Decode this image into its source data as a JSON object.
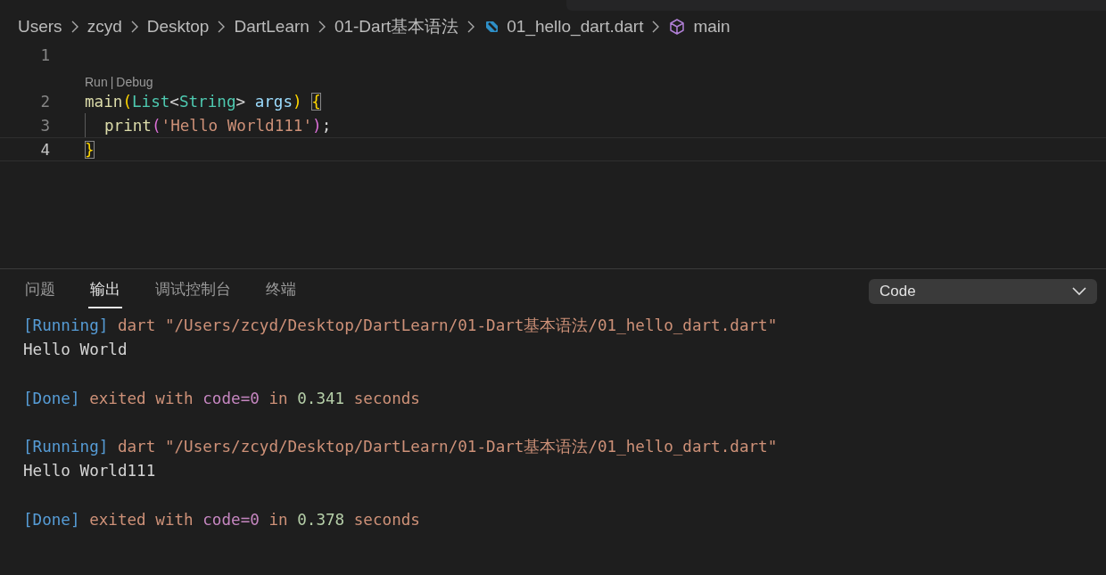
{
  "breadcrumb": [
    {
      "kind": "folder",
      "label": "Users"
    },
    {
      "kind": "folder",
      "label": "zcyd"
    },
    {
      "kind": "folder",
      "label": "Desktop"
    },
    {
      "kind": "folder",
      "label": "DartLearn"
    },
    {
      "kind": "folder",
      "label": "01-Dart基本语法"
    },
    {
      "kind": "file",
      "label": "01_hello_dart.dart"
    },
    {
      "kind": "symbol",
      "label": "main"
    }
  ],
  "editor": {
    "lines": [
      {
        "number": "1",
        "current": false
      },
      {
        "number": "2",
        "current": false,
        "codelens": {
          "run": "Run",
          "separator": "|",
          "debug": "Debug"
        },
        "tokens": [
          {
            "kind": "function",
            "text": "main"
          },
          {
            "kind": "bracket1",
            "text": "("
          },
          {
            "kind": "type",
            "text": "List"
          },
          {
            "kind": "punct",
            "text": "<"
          },
          {
            "kind": "type",
            "text": "String"
          },
          {
            "kind": "punct",
            "text": "> "
          },
          {
            "kind": "param",
            "text": "args"
          },
          {
            "kind": "bracket1",
            "text": ") "
          },
          {
            "kind": "matched",
            "text": "{"
          }
        ]
      },
      {
        "number": "3",
        "current": false,
        "indent": true,
        "tokens": [
          {
            "kind": "function",
            "text": "print"
          },
          {
            "kind": "bracket2",
            "text": "("
          },
          {
            "kind": "string",
            "text": "'Hello World111'"
          },
          {
            "kind": "bracket2",
            "text": ")"
          },
          {
            "kind": "plain",
            "text": ";"
          }
        ]
      },
      {
        "number": "4",
        "current": true,
        "tokens": [
          {
            "kind": "matched",
            "text": "}"
          }
        ]
      }
    ]
  },
  "panel": {
    "tabs": [
      {
        "label": "问题",
        "selected": false
      },
      {
        "label": "输出",
        "selected": true
      },
      {
        "label": "调试控制台",
        "selected": false
      },
      {
        "label": "终端",
        "selected": false
      }
    ],
    "dropdown": {
      "value": "Code"
    },
    "output": [
      {
        "kind": "text",
        "tokens": [
          {
            "kind": "tag",
            "text": "[Running]"
          },
          {
            "kind": "cmd",
            "text": " dart \"/Users/zcyd/Desktop/DartLearn/01-Dart基本语法/01_hello_dart.dart\""
          }
        ]
      },
      {
        "kind": "text",
        "tokens": [
          {
            "kind": "plain",
            "text": "Hello World"
          }
        ]
      },
      {
        "kind": "blank"
      },
      {
        "kind": "text",
        "tokens": [
          {
            "kind": "tag",
            "text": "[Done]"
          },
          {
            "kind": "cmd",
            "text": " exited with "
          },
          {
            "kind": "keyword",
            "text": "code=0"
          },
          {
            "kind": "cmd",
            "text": " in "
          },
          {
            "kind": "number",
            "text": "0.341"
          },
          {
            "kind": "cmd",
            "text": " seconds"
          }
        ]
      },
      {
        "kind": "blank"
      },
      {
        "kind": "text",
        "tokens": [
          {
            "kind": "tag",
            "text": "[Running]"
          },
          {
            "kind": "cmd",
            "text": " dart \"/Users/zcyd/Desktop/DartLearn/01-Dart基本语法/01_hello_dart.dart\""
          }
        ]
      },
      {
        "kind": "text",
        "tokens": [
          {
            "kind": "plain",
            "text": "Hello World111"
          }
        ]
      },
      {
        "kind": "blank"
      },
      {
        "kind": "text",
        "tokens": [
          {
            "kind": "tag",
            "text": "[Done]"
          },
          {
            "kind": "cmd",
            "text": " exited with "
          },
          {
            "kind": "keyword",
            "text": "code=0"
          },
          {
            "kind": "cmd",
            "text": " in "
          },
          {
            "kind": "number",
            "text": "0.378"
          },
          {
            "kind": "cmd",
            "text": " seconds"
          }
        ]
      }
    ]
  }
}
